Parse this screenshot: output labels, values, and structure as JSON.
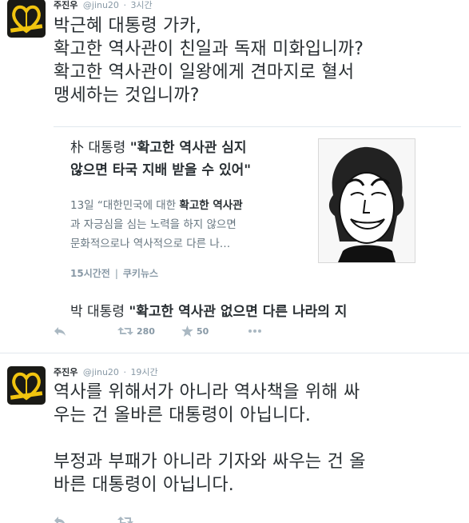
{
  "tweets": [
    {
      "name": "주진우",
      "handle": "@jinu20",
      "time": "3시간",
      "lines": [
        "박근혜 대통령 가카,",
        "확고한 역사관이 친일과 독재 미화입니까?",
        "확고한 역사관이 일왕에게 견마지로 혈서",
        "맹세하는 것입니까?"
      ],
      "card": {
        "title_line1_prefix": "朴 대통령 ",
        "title_line1_bold": "\"확고한 역사관 심지",
        "title_line2_bold": "않으면 타국 지배 받을 수 있어\"",
        "desc_line1_prefix": "13일 “대한민국에 대한 ",
        "desc_line1_bold": "확고한 역사관",
        "desc_line2": "과 자긍심을 심는 노력을 하지 않으면",
        "desc_line3": "문화적으로나 역사적으로 다른 나…",
        "meta_time": "15시간전",
        "meta_source": "쿠키뉴스",
        "next_prefix": "박 대통령 ",
        "next_bold": "\"확고한 역사관 없으면 다른 나라의 지"
      },
      "actions": {
        "reply_icon": "reply-icon",
        "retweet_icon": "retweet-icon",
        "retweet_count": "280",
        "favorite_icon": "star-icon",
        "favorite_count": "50",
        "more_icon": "more-icon"
      }
    },
    {
      "name": "주진우",
      "handle": "@jinu20",
      "time": "19시간",
      "lines": [
        "역사를 위해서가 아니라 역사책을 위해 싸",
        "우는 건 올바른 대통령이 아닙니다.",
        "",
        "부정과 부패가 아니라 기자와 싸우는 건 올",
        "바른 대통령이 아닙니다."
      ]
    }
  ],
  "colors": {
    "avatar_bg": "#1a1a16",
    "avatar_heart": "#f1c40f",
    "text": "#292f33",
    "muted": "#8899a6",
    "icon": "#aab8c2"
  }
}
